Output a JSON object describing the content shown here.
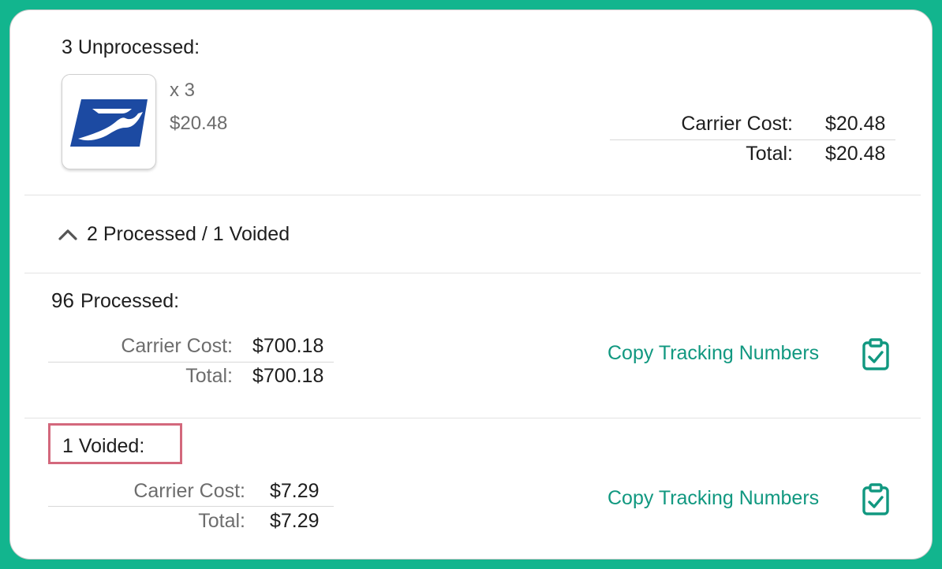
{
  "unprocessed": {
    "heading": "3 Unprocessed:",
    "carrier_logo": "usps-eagle-logo",
    "quantity": "x 3",
    "amount": "$20.48",
    "carrier_cost_label": "Carrier Cost:",
    "carrier_cost_value": "$20.48",
    "total_label": "Total:",
    "total_value": "$20.48"
  },
  "toggle": {
    "icon": "chevron-up-icon",
    "label": "2 Processed / 1 Voided"
  },
  "processed": {
    "count": "96",
    "label": "Processed:",
    "carrier_cost_label": "Carrier Cost:",
    "carrier_cost_value": "$700.18",
    "total_label": "Total:",
    "total_value": "$700.18",
    "copy_label": "Copy Tracking Numbers",
    "copy_icon": "clipboard-check-icon"
  },
  "voided": {
    "heading": "1 Voided:",
    "carrier_cost_label": "Carrier Cost:",
    "carrier_cost_value": "$7.29",
    "total_label": "Total:",
    "total_value": "$7.29",
    "copy_label": "Copy Tracking Numbers",
    "copy_icon": "clipboard-check-icon"
  },
  "colors": {
    "frame": "#12b58e",
    "accent": "#119880",
    "usps_blue": "#1c4aa2",
    "highlight_border": "#d3687c"
  }
}
